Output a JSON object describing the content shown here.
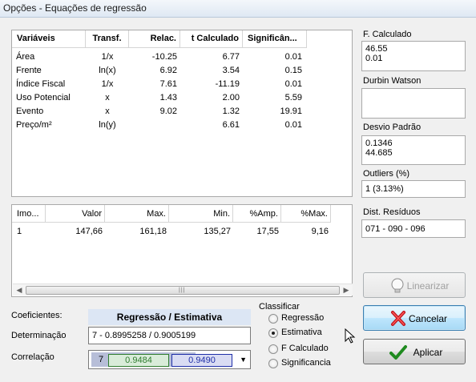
{
  "window": {
    "title": "Opções - Equações de regressão"
  },
  "variables_table": {
    "headers": [
      "Variáveis",
      "Transf.",
      "Relac.",
      "t Calculado",
      "Significân..."
    ],
    "rows": [
      {
        "variavel": "Área",
        "transf": "1/x",
        "relac": "-10.25",
        "t": "6.77",
        "sig": "0.01"
      },
      {
        "variavel": "Frente",
        "transf": "ln(x)",
        "relac": "6.92",
        "t": "3.54",
        "sig": "0.15"
      },
      {
        "variavel": "Índice Fiscal",
        "transf": "1/x",
        "relac": "7.61",
        "t": "-11.19",
        "sig": "0.01"
      },
      {
        "variavel": "Uso Potencial",
        "transf": "x",
        "relac": "1.43",
        "t": "2.00",
        "sig": "5.59"
      },
      {
        "variavel": "Evento",
        "transf": "x",
        "relac": "9.02",
        "t": "1.32",
        "sig": "19.91"
      },
      {
        "variavel": "Preço/m²",
        "transf": "ln(y)",
        "relac": "",
        "t": "6.61",
        "sig": "0.01"
      }
    ]
  },
  "estimate_table": {
    "headers": [
      "Imo...",
      "Valor",
      "Max.",
      "Min.",
      "%Amp.",
      "%Max."
    ],
    "rows": [
      {
        "imo": "1",
        "valor": "147,66",
        "max": "161,18",
        "min": "135,27",
        "amp": "17,55",
        "pmax": "9,16"
      }
    ]
  },
  "side": {
    "f_calculado": {
      "label": "F. Calculado",
      "lines": [
        "46.55",
        "0.01"
      ]
    },
    "durbin_watson": {
      "label": "Durbin Watson",
      "lines": []
    },
    "desvio_padrao": {
      "label": "Desvio Padrão",
      "lines": [
        "0.1346",
        "44.685"
      ]
    },
    "outliers": {
      "label": "Outliers (%)",
      "value": "1  (3.13%)"
    },
    "dist_residuos": {
      "label": "Dist. Resíduos",
      "value": "071 - 090 - 096"
    }
  },
  "buttons": {
    "linearizar": "Linearizar",
    "cancelar": "Cancelar",
    "aplicar": "Aplicar"
  },
  "bottom": {
    "coeficientes_label": "Coeficientes:",
    "section_title": "Regressão / Estimativa",
    "determinacao_label": "Determinação",
    "determinacao_value": "7 -  0.8995258  /  0.9005199",
    "correlacao_label": "Correlação",
    "correlacao_n": "7",
    "correlacao_a": "0.9484",
    "correlacao_b": "0.9490"
  },
  "classificar": {
    "label": "Classificar",
    "options": [
      "Regressão",
      "Estimativa",
      "F Calculado",
      "Significancia"
    ],
    "selected": "Estimativa"
  },
  "colors": {
    "green_value": "#2f7d2f",
    "blue_value": "#1f2fa8",
    "section_blue": "#dce6f4"
  }
}
